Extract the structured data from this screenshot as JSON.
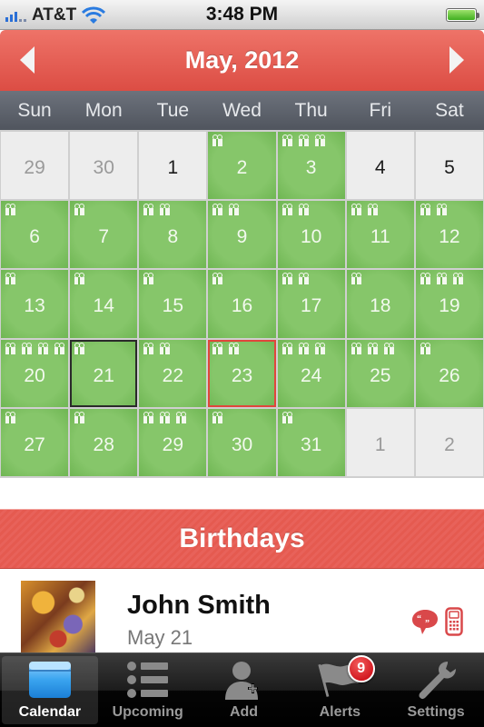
{
  "status_bar": {
    "carrier": "AT&T",
    "time": "3:48 PM",
    "signal_bars_active": 3,
    "signal_bars_total": 5,
    "battery_level_percent": 100
  },
  "calendar": {
    "month_title": "May, 2012",
    "prev_label": "previous month",
    "next_label": "next month",
    "weekdays": [
      "Sun",
      "Mon",
      "Tue",
      "Wed",
      "Thu",
      "Fri",
      "Sat"
    ],
    "today": 21,
    "selected": 23,
    "cells": [
      {
        "day": "29",
        "other_month": true,
        "gifts": 0
      },
      {
        "day": "30",
        "other_month": true,
        "gifts": 0
      },
      {
        "day": "1",
        "other_month": false,
        "gifts": 0
      },
      {
        "day": "2",
        "other_month": false,
        "gifts": 1
      },
      {
        "day": "3",
        "other_month": false,
        "gifts": 3
      },
      {
        "day": "4",
        "other_month": false,
        "gifts": 0
      },
      {
        "day": "5",
        "other_month": false,
        "gifts": 0
      },
      {
        "day": "6",
        "other_month": false,
        "gifts": 1
      },
      {
        "day": "7",
        "other_month": false,
        "gifts": 1
      },
      {
        "day": "8",
        "other_month": false,
        "gifts": 2
      },
      {
        "day": "9",
        "other_month": false,
        "gifts": 2
      },
      {
        "day": "10",
        "other_month": false,
        "gifts": 2
      },
      {
        "day": "11",
        "other_month": false,
        "gifts": 2
      },
      {
        "day": "12",
        "other_month": false,
        "gifts": 2
      },
      {
        "day": "13",
        "other_month": false,
        "gifts": 1
      },
      {
        "day": "14",
        "other_month": false,
        "gifts": 1
      },
      {
        "day": "15",
        "other_month": false,
        "gifts": 1
      },
      {
        "day": "16",
        "other_month": false,
        "gifts": 1
      },
      {
        "day": "17",
        "other_month": false,
        "gifts": 2
      },
      {
        "day": "18",
        "other_month": false,
        "gifts": 1
      },
      {
        "day": "19",
        "other_month": false,
        "gifts": 3
      },
      {
        "day": "20",
        "other_month": false,
        "gifts": 4
      },
      {
        "day": "21",
        "other_month": false,
        "gifts": 1
      },
      {
        "day": "22",
        "other_month": false,
        "gifts": 2
      },
      {
        "day": "23",
        "other_month": false,
        "gifts": 2
      },
      {
        "day": "24",
        "other_month": false,
        "gifts": 3
      },
      {
        "day": "25",
        "other_month": false,
        "gifts": 3
      },
      {
        "day": "26",
        "other_month": false,
        "gifts": 1
      },
      {
        "day": "27",
        "other_month": false,
        "gifts": 1
      },
      {
        "day": "28",
        "other_month": false,
        "gifts": 1
      },
      {
        "day": "29",
        "other_month": false,
        "gifts": 3
      },
      {
        "day": "30",
        "other_month": false,
        "gifts": 1
      },
      {
        "day": "31",
        "other_month": false,
        "gifts": 1
      },
      {
        "day": "1",
        "other_month": true,
        "gifts": 0
      },
      {
        "day": "2",
        "other_month": true,
        "gifts": 0
      }
    ]
  },
  "birthdays": {
    "section_title": "Birthdays",
    "items": [
      {
        "name": "John Smith",
        "date": "May 21",
        "actions": [
          "message-icon",
          "phone-icon"
        ]
      }
    ]
  },
  "tabbar": {
    "tabs": [
      {
        "label": "Calendar",
        "icon": "calendar-icon",
        "active": true
      },
      {
        "label": "Upcoming",
        "icon": "list-icon",
        "active": false
      },
      {
        "label": "Add",
        "icon": "add-person-icon",
        "active": false
      },
      {
        "label": "Alerts",
        "icon": "flag-icon",
        "active": false,
        "badge": "9"
      },
      {
        "label": "Settings",
        "icon": "wrench-icon",
        "active": false
      }
    ]
  },
  "colors": {
    "header_red": "#e35a51",
    "event_green": "#7fc063",
    "today_outline": "#2a2a2a",
    "selected_outline": "#e0463c",
    "badge_red": "#d0101a"
  }
}
